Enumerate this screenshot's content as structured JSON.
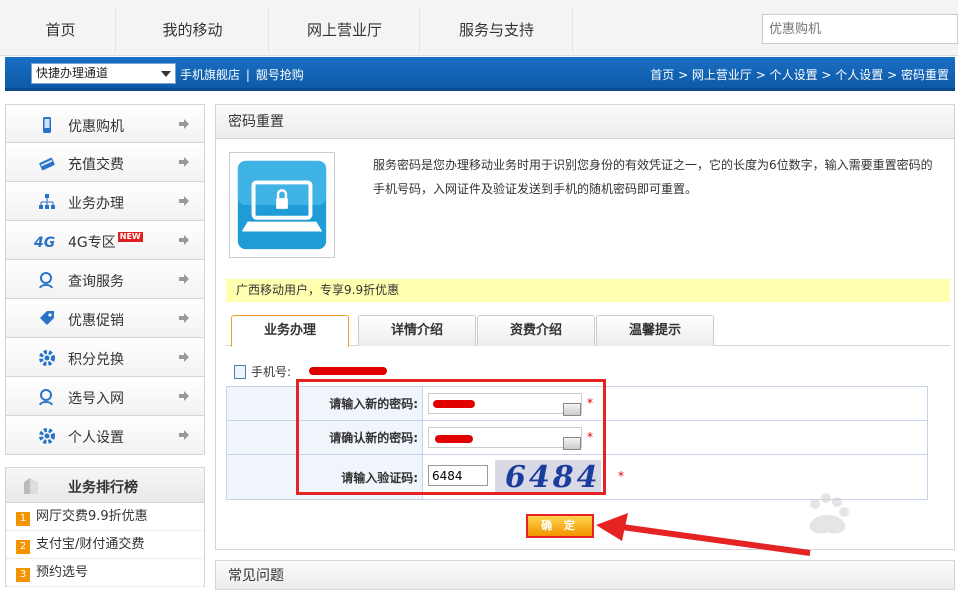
{
  "nav": {
    "items": [
      "首页",
      "我的移动",
      "网上营业厅",
      "服务与支持"
    ],
    "search_placeholder": "优惠购机"
  },
  "bluebar": {
    "quick_select": "快捷办理通道",
    "link1": "手机旗舰店",
    "separator": "|",
    "link2": "靓号抢购",
    "breadcrumb": "首页 > 网上营业厅 > 个人设置 > 个人设置 > 密码重置"
  },
  "sidebar": {
    "items": [
      {
        "label": "优惠购机",
        "icon": "phone-icon"
      },
      {
        "label": "充值交费",
        "icon": "card-icon"
      },
      {
        "label": "业务办理",
        "icon": "network-icon"
      },
      {
        "label": "4G专区",
        "icon": "4g-icon",
        "badge": "NEW"
      },
      {
        "label": "查询服务",
        "icon": "person-search-icon"
      },
      {
        "label": "优惠促销",
        "icon": "tag-icon"
      },
      {
        "label": "积分兑换",
        "icon": "gear-icon"
      },
      {
        "label": "选号入网",
        "icon": "person-search-icon"
      },
      {
        "label": "个人设置",
        "icon": "gear-icon"
      }
    ]
  },
  "ranking": {
    "title": "业务排行榜",
    "items": [
      {
        "num": "1",
        "label": "网厅交费9.9折优惠"
      },
      {
        "num": "2",
        "label": "支付宝/财付通交费"
      },
      {
        "num": "3",
        "label": "预约选号"
      }
    ]
  },
  "panel": {
    "title": "密码重置",
    "description": "服务密码是您办理移动业务时用于识别您身份的有效凭证之一，它的长度为6位数字，输入需要重置密码的手机号码，入网证件及验证发送到手机的随机密码即可重置。",
    "promo": "广西移动用户，专享9.9折优惠",
    "tabs": [
      "业务办理",
      "详情介绍",
      "资费介绍",
      "温馨提示"
    ],
    "phone_label": "手机号:",
    "form": {
      "new_pwd_label": "请输入新的密码:",
      "confirm_pwd_label": "请确认新的密码:",
      "captcha_label": "请输入验证码:",
      "captcha_value": "6484",
      "captcha_image_text": "6484",
      "required_mark": "*"
    },
    "submit_label": "确 定"
  },
  "faq": {
    "title": "常见问题"
  },
  "colors": {
    "brand_blue": "#1a6fc4",
    "accent_orange": "#f29400",
    "annotation_red": "#e52323",
    "promo_yellow": "#ffffb0"
  }
}
